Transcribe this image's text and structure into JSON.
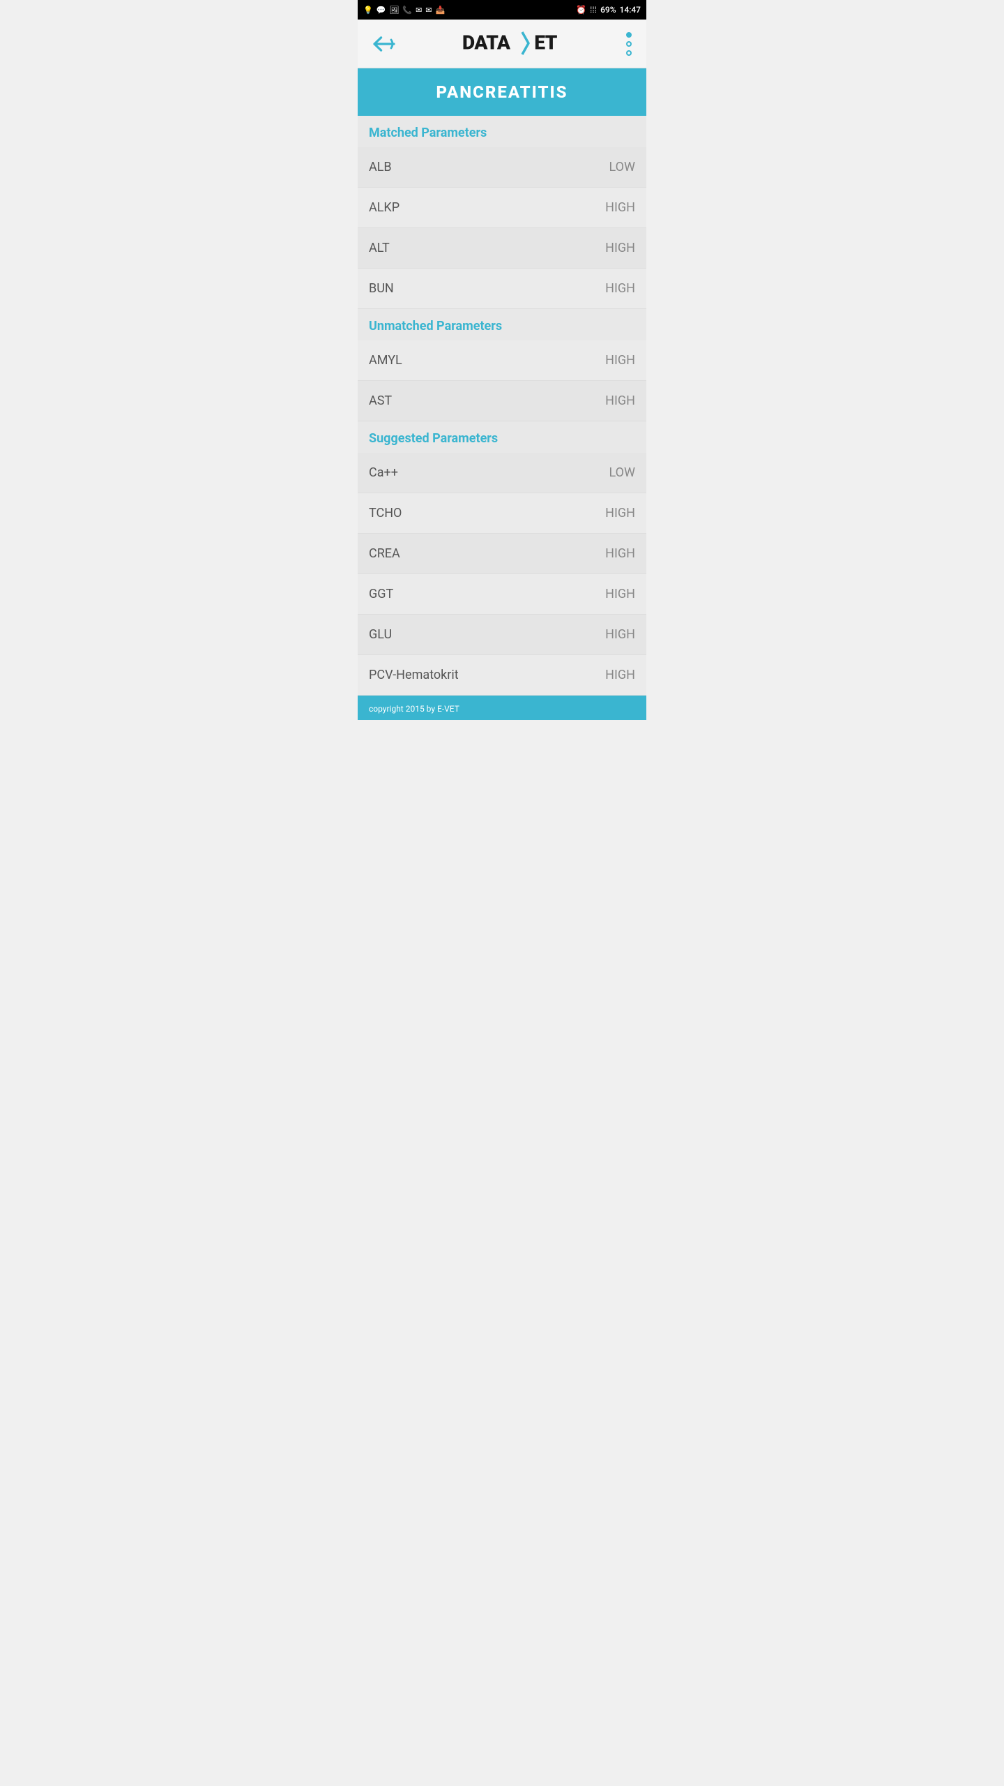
{
  "statusBar": {
    "time": "14:47",
    "battery": "69%",
    "icons": [
      "notification",
      "whatsapp",
      "image",
      "phone",
      "gmail1",
      "gmail2",
      "inbox"
    ]
  },
  "header": {
    "backLabel": "←",
    "logoText": "DATA",
    "logoSlash": "/",
    "logoEnd": "ET",
    "menuDots": 3
  },
  "titleBanner": {
    "text": "PANCREATITIS"
  },
  "sections": [
    {
      "id": "matched",
      "header": "Matched Parameters",
      "params": [
        {
          "name": "ALB",
          "value": "LOW"
        },
        {
          "name": "ALKP",
          "value": "HIGH"
        },
        {
          "name": "ALT",
          "value": "HIGH"
        },
        {
          "name": "BUN",
          "value": "HIGH"
        }
      ]
    },
    {
      "id": "unmatched",
      "header": "Unmatched Parameters",
      "params": [
        {
          "name": "AMYL",
          "value": "HIGH"
        },
        {
          "name": "AST",
          "value": "HIGH"
        }
      ]
    },
    {
      "id": "suggested",
      "header": "Suggested Parameters",
      "params": [
        {
          "name": "Ca++",
          "value": "LOW"
        },
        {
          "name": "TCHO",
          "value": "HIGH"
        },
        {
          "name": "CREA",
          "value": "HIGH"
        },
        {
          "name": "GGT",
          "value": "HIGH"
        },
        {
          "name": "GLU",
          "value": "HIGH"
        },
        {
          "name": "PCV-Hematokrit",
          "value": "HIGH"
        }
      ]
    }
  ],
  "footer": {
    "text": "copyright 2015 by E-VET"
  }
}
